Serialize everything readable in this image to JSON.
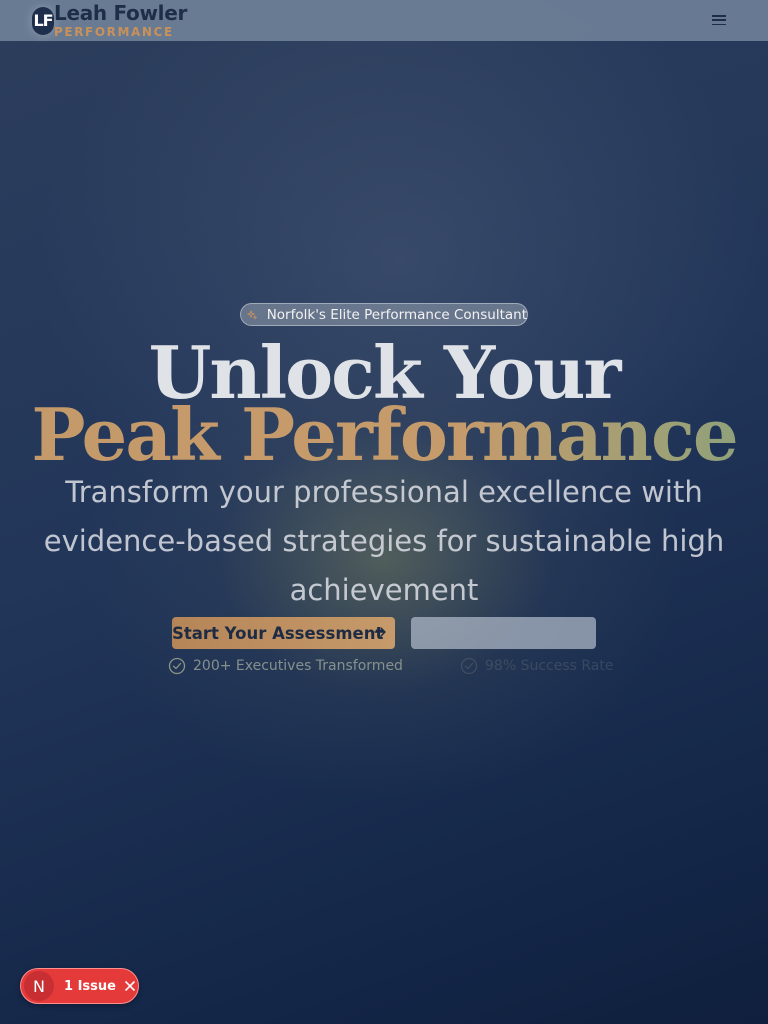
{
  "nav": {
    "logo_initials": "LF",
    "logo_name": "Leah Fowler",
    "logo_subtitle": "PERFORMANCE",
    "menu_icon": "hamburger-menu-icon"
  },
  "hero": {
    "pill_icon": "sparkles-icon",
    "pill_text": "Norfolk's Elite Performance Consultant",
    "headline_line1": "Unlock Your",
    "headline_line2": "Peak Performance",
    "subtitle": "Transform your professional excellence with evidence-based strategies for sustainable high achievement",
    "primary_button_label": "Start Your Assessment",
    "primary_button_icon": "arrow-right-icon",
    "secondary_button_label": "",
    "stats": [
      {
        "icon": "check-circle-icon",
        "text": "200+ Executives Transformed"
      },
      {
        "icon": "check-circle-icon",
        "text": "98% Success Rate"
      }
    ]
  },
  "issue_badge": {
    "initial": "N",
    "label": "1 Issue",
    "close_icon": "close-icon"
  },
  "colors": {
    "accent_gold": "#c69a6a",
    "accent_green": "#8aa27c",
    "navy": "#1e2f4d",
    "issue_red": "#e53a3a"
  }
}
